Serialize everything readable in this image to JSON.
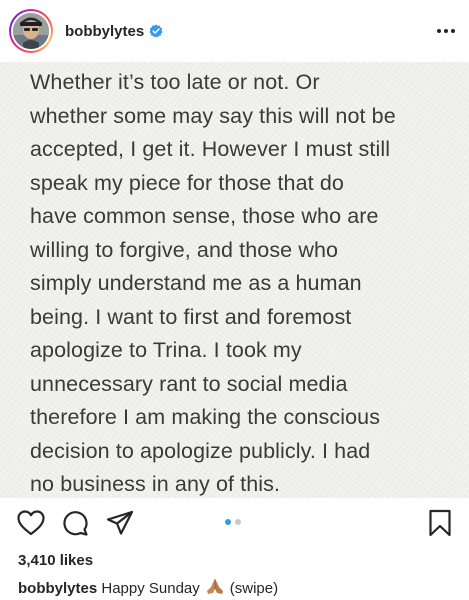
{
  "header": {
    "username": "bobbylytes",
    "verified_icon": "verified-badge-icon",
    "more_icon": "more-options-icon"
  },
  "post": {
    "text": "Whether it’s too late or not. Or\nwhether some may say this will not be\naccepted, I get it. However I must still\nspeak my piece for those that do\nhave common sense, those who are\nwilling to forgive, and those who\nsimply understand me as a human\nbeing. I want to first and foremost\napologize to Trina. I took my\nunnecessary rant to social media\ntherefore I am making the conscious\ndecision to apologize publicly. I had\nno business in any of this."
  },
  "actions": {
    "icons": [
      "heart-icon",
      "comment-icon",
      "share-icon",
      "bookmark-icon"
    ],
    "carousel": {
      "total": 2,
      "current": 1
    },
    "accent_color": "#3897f0"
  },
  "likes": {
    "text": "3,410 likes"
  },
  "caption": {
    "username": "bobbylytes",
    "text_before": "Happy Sunday",
    "emoji_icon": "folded-hands-icon",
    "text_after": "(swipe)"
  }
}
